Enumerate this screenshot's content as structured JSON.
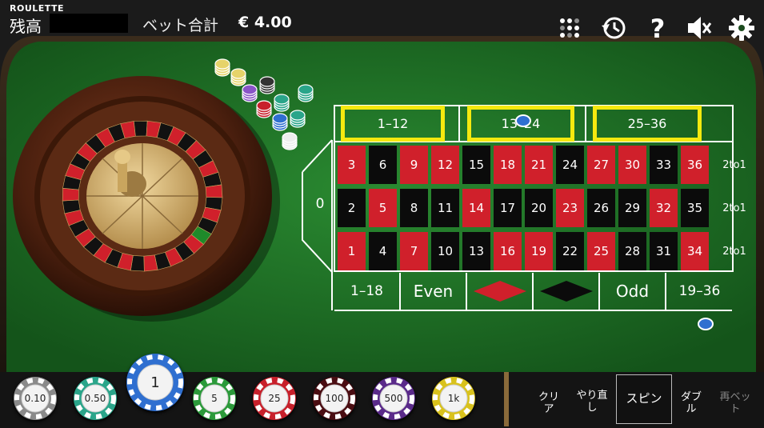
{
  "header": {
    "logo": "ROULETTE",
    "balance_label": "残高",
    "bet_total_label": "ベット合計",
    "bet_total_value": "€ 4.00"
  },
  "toolbar_icons": [
    "grid-menu-icon",
    "history-icon",
    "help-icon",
    "mute-icon",
    "settings-icon"
  ],
  "table": {
    "zero": "0",
    "rows": [
      [
        {
          "n": "3",
          "c": "red"
        },
        {
          "n": "6",
          "c": "black"
        },
        {
          "n": "9",
          "c": "red"
        },
        {
          "n": "12",
          "c": "red"
        },
        {
          "n": "15",
          "c": "black"
        },
        {
          "n": "18",
          "c": "red"
        },
        {
          "n": "21",
          "c": "red"
        },
        {
          "n": "24",
          "c": "black"
        },
        {
          "n": "27",
          "c": "red"
        },
        {
          "n": "30",
          "c": "red"
        },
        {
          "n": "33",
          "c": "black"
        },
        {
          "n": "36",
          "c": "red"
        }
      ],
      [
        {
          "n": "2",
          "c": "black"
        },
        {
          "n": "5",
          "c": "red"
        },
        {
          "n": "8",
          "c": "black"
        },
        {
          "n": "11",
          "c": "black"
        },
        {
          "n": "14",
          "c": "red"
        },
        {
          "n": "17",
          "c": "black"
        },
        {
          "n": "20",
          "c": "black"
        },
        {
          "n": "23",
          "c": "red"
        },
        {
          "n": "26",
          "c": "black"
        },
        {
          "n": "29",
          "c": "black"
        },
        {
          "n": "32",
          "c": "red"
        },
        {
          "n": "35",
          "c": "black"
        }
      ],
      [
        {
          "n": "1",
          "c": "red"
        },
        {
          "n": "4",
          "c": "black"
        },
        {
          "n": "7",
          "c": "red"
        },
        {
          "n": "10",
          "c": "black"
        },
        {
          "n": "13",
          "c": "black"
        },
        {
          "n": "16",
          "c": "red"
        },
        {
          "n": "19",
          "c": "red"
        },
        {
          "n": "22",
          "c": "black"
        },
        {
          "n": "25",
          "c": "red"
        },
        {
          "n": "28",
          "c": "black"
        },
        {
          "n": "31",
          "c": "black"
        },
        {
          "n": "34",
          "c": "red"
        }
      ]
    ],
    "column_bets": [
      "2to1",
      "2to1",
      "2to1"
    ],
    "dozens": [
      "1–12",
      "13–24",
      "25–36"
    ],
    "outside": [
      "1–18",
      "Even",
      "",
      "",
      "Odd",
      "19–36"
    ]
  },
  "chips": [
    {
      "label": "0.10",
      "color": "#8a8a8a"
    },
    {
      "label": "0.50",
      "color": "#2aa58a"
    },
    {
      "label": "1",
      "color": "#2f6fd0"
    },
    {
      "label": "5",
      "color": "#2b9a3a"
    },
    {
      "label": "25",
      "color": "#c8202b"
    },
    {
      "label": "100",
      "color": "#4a0d12"
    },
    {
      "label": "500",
      "color": "#5a2a8a"
    },
    {
      "label": "1k",
      "color": "#d9c21c"
    }
  ],
  "controls": {
    "clear": "クリア",
    "undo": "やり直し",
    "spin": "スピン",
    "double": "ダブル",
    "rebet": "再ベット"
  },
  "colors": {
    "felt": "#1f6f25",
    "red": "#d0202b",
    "black": "#0b0b0b",
    "highlight": "#f5e90f"
  }
}
